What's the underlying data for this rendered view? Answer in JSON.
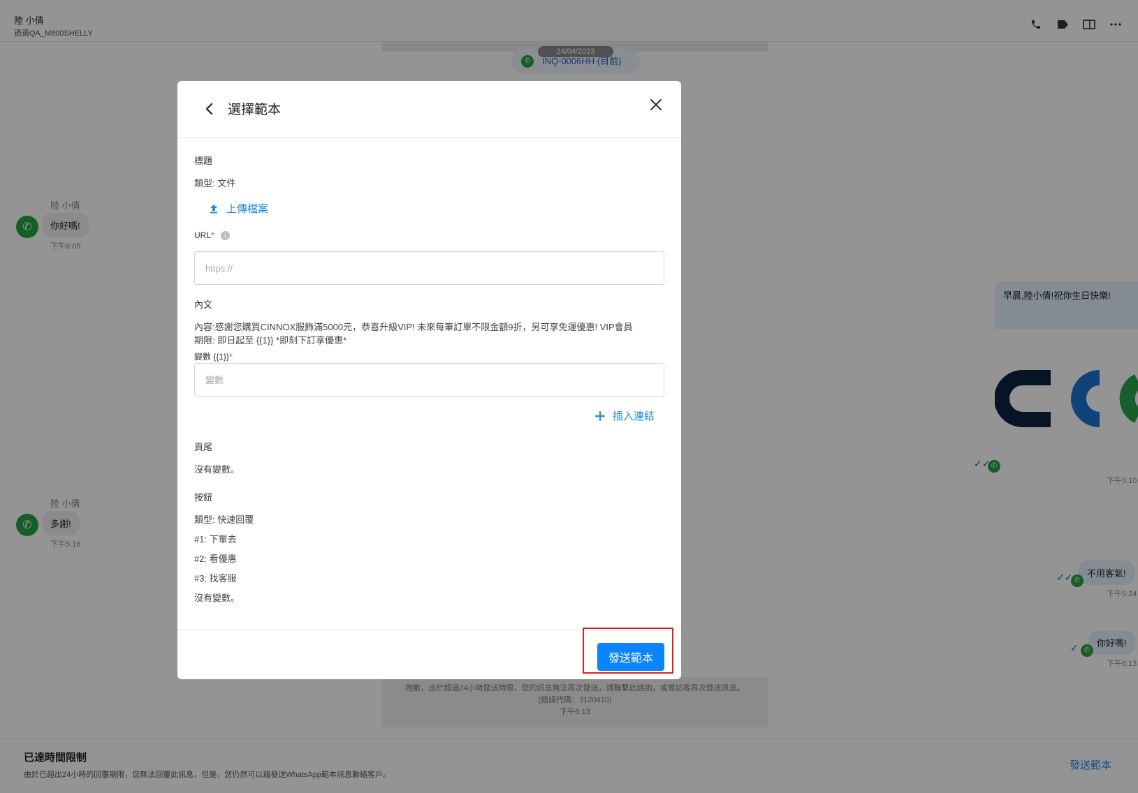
{
  "header": {
    "contact_name": "陸 小倩",
    "channel_sub": "透過QA_M800SHELLY",
    "icons": [
      "phone-icon",
      "tag-icon",
      "split-view-icon",
      "more-icon"
    ]
  },
  "timeline": {
    "date": "24/04/2023",
    "inquiry_label": "INQ-0006HH (目前)"
  },
  "messages": {
    "in1": {
      "name": "陸 小倩",
      "text": "你好嗎!",
      "time": "下午6:05"
    },
    "out_image": {
      "caption": "早晨,陸小倩!祝你生日快樂!",
      "time": "下午5:10"
    },
    "in2": {
      "name": "陸 小倩",
      "text": "多謝!",
      "time": "下午5:16"
    },
    "out2": {
      "text": "不用客氣!",
      "time": "下午5:24"
    },
    "out3": {
      "text": "你好嗎!",
      "time": "下午6:13"
    },
    "error": {
      "line1": "抱歉，由於超過24小時發送時限，您的訊息無法再次發送，請聯繫此諮詢，或等訪客再次發送訊息。",
      "line2": "(錯誤代碼：3120410)",
      "time": "下午6:13"
    }
  },
  "bottom": {
    "title": "已達時間限制",
    "desc": "由於已超出24小時的回覆期限，您無法回覆此訊息，但是，您仍然可以藉發送WhatsApp範本訊息聯絡客戶。",
    "send_template_link": "發送範本"
  },
  "modal": {
    "title": "選擇範本",
    "header_section": {
      "label": "標題",
      "type_text": "類型: 文件",
      "upload_label": "上傳檔案",
      "url_label": "URL",
      "url_required": "*",
      "url_placeholder": "https://"
    },
    "body_section": {
      "label": "內文",
      "content_line1": "內容:感謝您購買CINNOX服飾滿5000元，恭喜升級VIP! 未來每筆訂單不限金額9折，另可享免運優惠! VIP會員",
      "content_line2": "期限: 即日起至 {{1}} *即刻下訂享優惠*",
      "variable_label": "變數 {{1}}",
      "variable_required": "*",
      "variable_placeholder": "變數",
      "insert_link_label": "插入連結"
    },
    "footer_section": {
      "label": "頁尾",
      "no_variable": "沒有變數。"
    },
    "buttons_section": {
      "label": "按鈕",
      "type_text": "類型: 快速回覆",
      "items": [
        "#1: 下單去",
        "#2: 看優惠",
        "#3: 找客服"
      ],
      "no_variable": "沒有變數。"
    },
    "send_button": "發送範本"
  }
}
